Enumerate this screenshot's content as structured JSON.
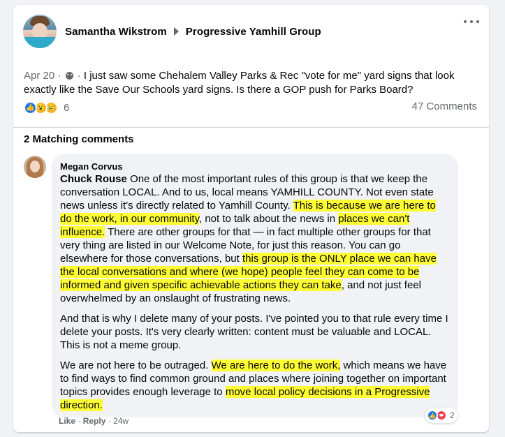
{
  "post": {
    "author": "Samantha Wikstrom",
    "group": "Progressive Yamhill Group",
    "date": "Apr 20",
    "separator": "·",
    "separator2": "·",
    "text": "I just saw some Chehalem Valley Parks & Rec \"vote for me\" yard signs that look exactly like the Save Our Schools yard signs. Is there a GOP push for Parks Board?",
    "reaction_count": "6",
    "comments_label": "47 Comments",
    "reaction_icons": [
      "like-icon",
      "wow-icon",
      "sad-icon"
    ]
  },
  "matching_comments_label": "2 Matching comments",
  "comment": {
    "author": "Megan Corvus",
    "mention": "Chuck Rouse",
    "p1": [
      {
        "t": " One of the most important rules of this group is that we keep the conversation LOCAL. And to us, local means YAMHILL COUNTY. Not even state news unless it's directly related to Yamhill County. ",
        "hl": false
      },
      {
        "t": "This is because we are here to do the work, in our community",
        "hl": true
      },
      {
        "t": ", not to talk about the news in ",
        "hl": false
      },
      {
        "t": "places we can't influence.",
        "hl": true
      },
      {
        "t": " There are other groups for that — in fact multiple other groups for that very thing are listed in our Welcome Note, for just this reason. You can go elsewhere for those conversations, but ",
        "hl": false
      },
      {
        "t": "this group is the ONLY place we can have the local conversations and where (we hope) people feel they can come to be informed and ",
        "hl": true
      },
      {
        "t": "given specific achievable actions they can take",
        "hl": true
      },
      {
        "t": ", and not just feel overwhelmed by an onslaught of frustrating news.",
        "hl": false
      }
    ],
    "p2": "And that is why I delete many of your posts. I've pointed you to that rule every time I delete your posts. It's very clearly written: content must be valuable and LOCAL. This is not a meme group.",
    "p3": [
      {
        "t": "We are not here to be outraged. ",
        "hl": false
      },
      {
        "t": "We are here to do the work,",
        "hl": true
      },
      {
        "t": " which means we have to find ways to find common ground and places where joining together on important topics provides enough leverage to ",
        "hl": false
      },
      {
        "t": "move local policy decisions in a Progressive direction.",
        "hl": true
      }
    ],
    "like_label": "Like",
    "dot": "·",
    "reply_label": "Reply",
    "dot2": "·",
    "age": "24w",
    "reaction_count": "2",
    "reaction_icons": [
      "like-icon",
      "love-icon"
    ]
  },
  "colors": {
    "highlight": "#ffff33",
    "like_blue": "#1877f2",
    "secondary_text": "#65676b"
  }
}
